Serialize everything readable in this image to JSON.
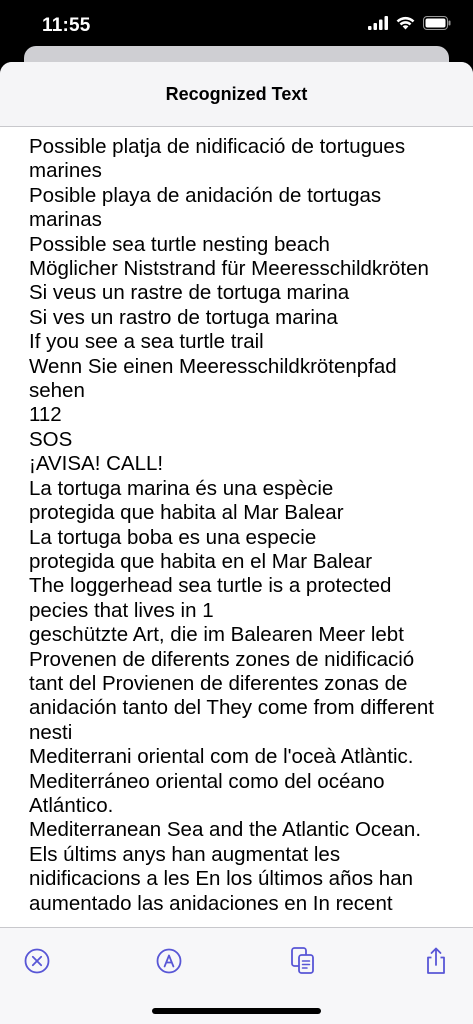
{
  "status_bar": {
    "time": "11:55"
  },
  "sheet": {
    "title": "Recognized Text",
    "lines": [
      "Possible platja de nidificació de tortugues",
      "marines",
      "Posible playa de anidación de tortugas",
      "marinas",
      "Possible sea turtle nesting beach",
      "Möglicher Niststrand für Meeresschildkröten",
      "Si veus un rastre de tortuga marina",
      "Si ves un rastro de tortuga marina",
      "If you see a sea turtle trail",
      "Wenn Sie einen Meeresschildkrötenpfad",
      "sehen",
      "112",
      "SOS",
      "¡AVISA! CALL!",
      "La tortuga marina és una espècie",
      "protegida que habita al Mar Balear",
      "La tortuga boba es una especie",
      "protegida que habita en el Mar Balear",
      "The loggerhead sea turtle is a protected",
      "pecies that lives in 1",
      "geschützte Art, die im Balearen Meer lebt",
      "Provenen de diferents zones de nidificació",
      "tant del Provienen de diferentes zonas de",
      "anidación tanto del They come from different",
      "nesti",
      "Mediterrani oriental com de l'oceà Atlàntic.",
      "Mediterráneo oriental como del océano",
      "Atlántico.",
      "Mediterranean Sea and the Atlantic Ocean.",
      "Els últims anys han augmentat les",
      "nidificacions a les En los últimos años han",
      "aumentado las anidaciones en In recent"
    ]
  },
  "toolbar": {
    "buttons": [
      "close-icon",
      "translate-icon",
      "copy-icon",
      "share-icon"
    ],
    "accent_color": "#5856D6"
  }
}
